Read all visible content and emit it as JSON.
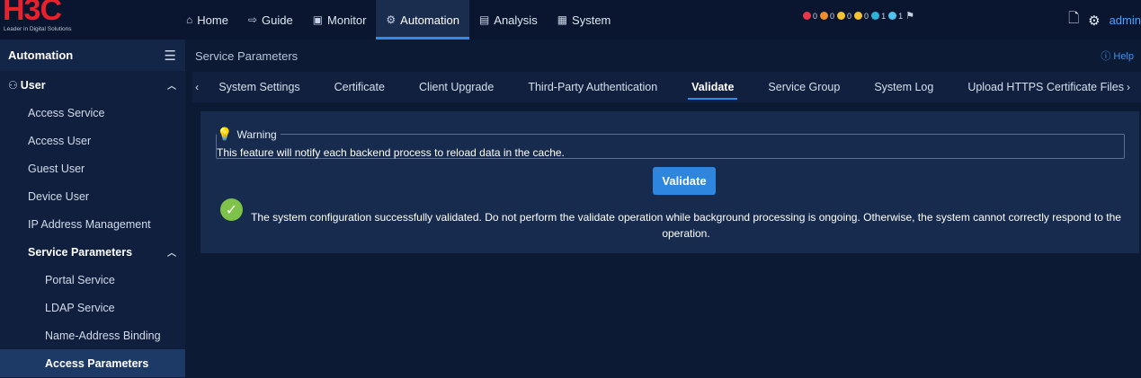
{
  "brand": {
    "logo": "H3C",
    "tagline": "Leader in Digital Solutions",
    "logo_color": "#e8212c"
  },
  "nav": {
    "items": [
      {
        "label": "Home",
        "icon": "home-icon"
      },
      {
        "label": "Guide",
        "icon": "guide-icon"
      },
      {
        "label": "Monitor",
        "icon": "monitor-icon"
      },
      {
        "label": "Automation",
        "icon": "automation-icon",
        "active": true
      },
      {
        "label": "Analysis",
        "icon": "analysis-icon"
      },
      {
        "label": "System",
        "icon": "system-icon"
      }
    ],
    "accent": "#2e8bf0"
  },
  "alarms": [
    {
      "count": "0",
      "color": "#e8364a"
    },
    {
      "count": "0",
      "color": "#f08c2a"
    },
    {
      "count": "0",
      "color": "#f2c230"
    },
    {
      "count": "0",
      "color": "#f2c230"
    },
    {
      "count": "1",
      "color": "#2bb3d8"
    },
    {
      "count": "1",
      "color": "#4fc3f0"
    }
  ],
  "user": {
    "name": "admin"
  },
  "sidebar": {
    "title": "Automation",
    "group": "User",
    "items": [
      {
        "label": "Access Service"
      },
      {
        "label": "Access User"
      },
      {
        "label": "Guest User"
      },
      {
        "label": "Device User"
      },
      {
        "label": "IP Address Management"
      },
      {
        "label": "Service Parameters"
      },
      {
        "label": "Portal Service"
      },
      {
        "label": "LDAP Service"
      },
      {
        "label": "Name-Address Binding"
      },
      {
        "label": "Access Parameters"
      }
    ]
  },
  "main": {
    "breadcrumb": "Service Parameters",
    "help": "Help",
    "tabs": [
      {
        "label": "System Settings"
      },
      {
        "label": "Certificate"
      },
      {
        "label": "Client Upgrade"
      },
      {
        "label": "Third-Party Authentication"
      },
      {
        "label": "Validate",
        "active": true
      },
      {
        "label": "Service Group"
      },
      {
        "label": "System Log"
      },
      {
        "label": "Upload HTTPS Certificate Files"
      }
    ],
    "warning": {
      "title": "Warning",
      "text": "This feature will notify each backend process to reload data in the cache."
    },
    "validate_button": "Validate",
    "success_message": "The system configuration successfully validated. Do not perform the validate operation while background processing is ongoing. Otherwise, the system cannot correctly respond to the operation."
  }
}
